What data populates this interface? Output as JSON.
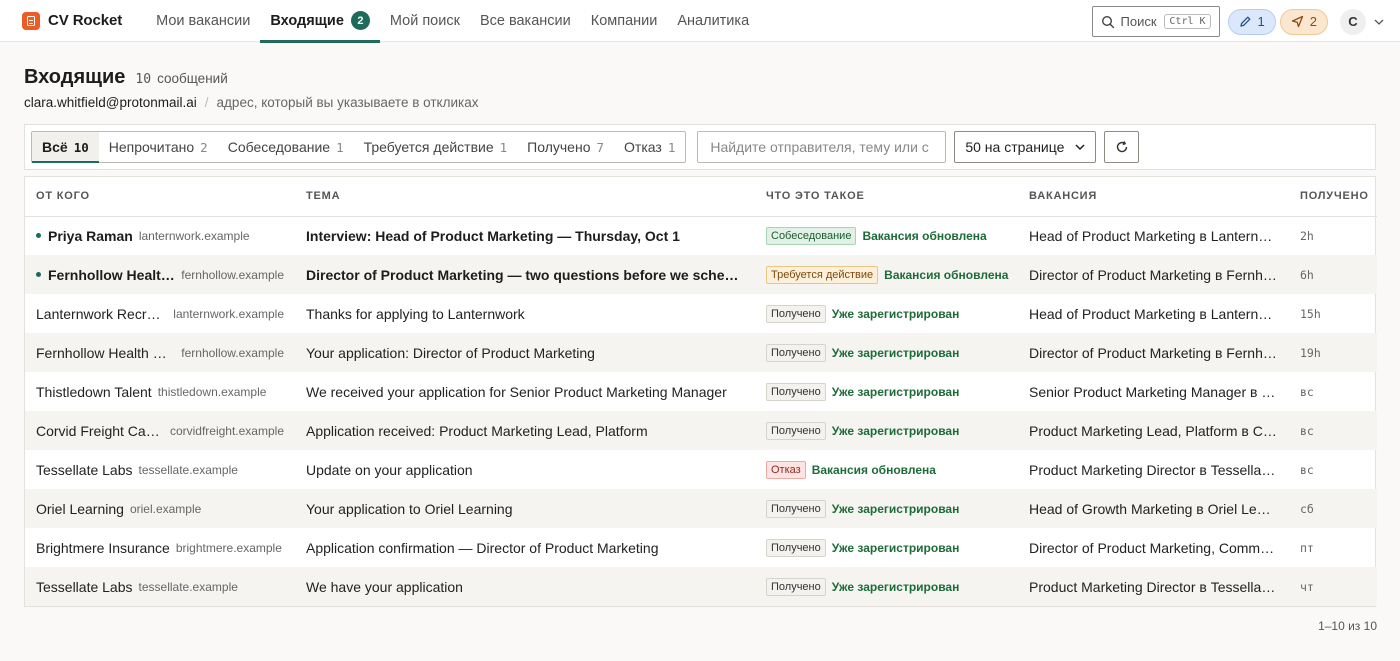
{
  "app": {
    "name": "CV Rocket",
    "nav": [
      {
        "label": "Мои вакансии"
      },
      {
        "label": "Входящие",
        "badge": "2"
      },
      {
        "label": "Мой поиск"
      },
      {
        "label": "Все вакансии"
      },
      {
        "label": "Компании"
      },
      {
        "label": "Аналитика"
      }
    ],
    "search_label": "Поиск",
    "search_kbd": "Ctrl K",
    "drafts_count": "1",
    "sent_count": "2",
    "avatar_initial": "C",
    "accent_color": "#1e6b5c",
    "brand_color": "#ef5b25"
  },
  "header": {
    "title": "Входящие",
    "count": "10",
    "count_label": "сообщений",
    "email": "clara.whitfield@protonmail.ai",
    "separator": "/",
    "hint": "адрес, который вы указываете в откликах"
  },
  "filters": {
    "tabs": [
      {
        "label": "Всё",
        "count": "10"
      },
      {
        "label": "Непрочитано",
        "count": "2"
      },
      {
        "label": "Собеседование",
        "count": "1"
      },
      {
        "label": "Требуется действие",
        "count": "1"
      },
      {
        "label": "Получено",
        "count": "7"
      },
      {
        "label": "Отказ",
        "count": "1"
      }
    ],
    "search_placeholder": "Найдите отправителя, тему или с",
    "per_page": "50 на странице"
  },
  "table": {
    "columns": [
      "ОТ КОГО",
      "ТЕМА",
      "ЧТО ЭТО ТАКОЕ",
      "ВАКАНСИЯ",
      "ПОЛУЧЕНО"
    ],
    "rows": [
      {
        "from": "Priya Raman",
        "domain": "lanternwork.example",
        "subject": "Interview: Head of Product Marketing — Thursday, Oct 1",
        "tag": "Собеседование",
        "status": "Вакансия обновлена",
        "vacancy": "Head of Product Marketing в Lanternwork",
        "received": "2h"
      },
      {
        "from": "Fernhollow Health Recruiting",
        "domain": "fernhollow.example",
        "subject": "Director of Product Marketing — two questions before we schedule",
        "tag": "Требуется действие",
        "status": "Вакансия обновлена",
        "vacancy": "Director of Product Marketing в Fernhollow Health",
        "received": "6h"
      },
      {
        "from": "Lanternwork Recruiting",
        "domain": "lanternwork.example",
        "subject": "Thanks for applying to Lanternwork",
        "tag": "Получено",
        "status": "Уже зарегистрирован",
        "vacancy": "Head of Product Marketing в Lanternwork",
        "received": "15h"
      },
      {
        "from": "Fernhollow Health Recruiting",
        "domain": "fernhollow.example",
        "subject": "Your application: Director of Product Marketing",
        "tag": "Получено",
        "status": "Уже зарегистрирован",
        "vacancy": "Director of Product Marketing в Fernhollow Health",
        "received": "19h"
      },
      {
        "from": "Thistledown Talent",
        "domain": "thistledown.example",
        "subject": "We received your application for Senior Product Marketing Manager",
        "tag": "Получено",
        "status": "Уже зарегистрирован",
        "vacancy": "Senior Product Marketing Manager в Thistledown",
        "received": "вс"
      },
      {
        "from": "Corvid Freight Careers",
        "domain": "corvidfreight.example",
        "subject": "Application received: Product Marketing Lead, Platform",
        "tag": "Получено",
        "status": "Уже зарегистрирован",
        "vacancy": "Product Marketing Lead, Platform в Corvid Freight",
        "received": "вс"
      },
      {
        "from": "Tessellate Labs",
        "domain": "tessellate.example",
        "subject": "Update on your application",
        "tag": "Отказ",
        "status": "Вакансия обновлена",
        "vacancy": "Product Marketing Director в Tessellate Labs",
        "received": "вс"
      },
      {
        "from": "Oriel Learning",
        "domain": "oriel.example",
        "subject": "Your application to Oriel Learning",
        "tag": "Получено",
        "status": "Уже зарегистрирован",
        "vacancy": "Head of Growth Marketing в Oriel Learning",
        "received": "сб"
      },
      {
        "from": "Brightmere Insurance",
        "domain": "brightmere.example",
        "subject": "Application confirmation — Director of Product Marketing",
        "tag": "Получено",
        "status": "Уже зарегистрирован",
        "vacancy": "Director of Product Marketing, Commercial в Brightmere",
        "received": "пт"
      },
      {
        "from": "Tessellate Labs",
        "domain": "tessellate.example",
        "subject": "We have your application",
        "tag": "Получено",
        "status": "Уже зарегистрирован",
        "vacancy": "Product Marketing Director в Tessellate Labs",
        "received": "чт"
      }
    ]
  },
  "pagination": "1–10 из 10"
}
